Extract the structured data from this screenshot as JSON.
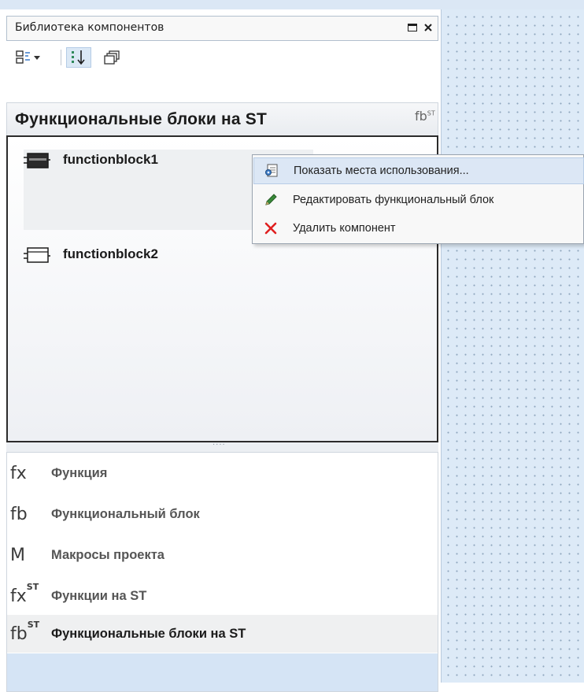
{
  "panel": {
    "title": "Библиотека компонентов"
  },
  "toolbar": {
    "view_mode_icon": "list-view-dropdown-icon",
    "sort_icon": "sort-order-icon",
    "group_icon": "copy-layers-icon"
  },
  "section": {
    "title": "Функциональные блоки на ST",
    "icon_text": "fbST"
  },
  "components": [
    {
      "name": "functionblock1",
      "selected": true
    },
    {
      "name": "functionblock2",
      "selected": false
    }
  ],
  "context_menu": {
    "items": [
      {
        "label": "Показать места использования...",
        "icon": "find-usages-icon"
      },
      {
        "label": "Редактировать функциональный блок",
        "icon": "pencil-icon"
      },
      {
        "label": "Удалить компонент",
        "icon": "red-x-delete-icon"
      }
    ]
  },
  "categories": [
    {
      "icon_main": "fx",
      "icon_sup": "",
      "label": "Функция"
    },
    {
      "icon_main": "fb",
      "icon_sup": "",
      "label": "Функциональный блок"
    },
    {
      "icon_main": "M",
      "icon_sup": "",
      "label": "Макросы проекта"
    },
    {
      "icon_main": "fx",
      "icon_sup": "ST",
      "label": "Функции на ST"
    },
    {
      "icon_main": "fb",
      "icon_sup": "ST",
      "label": "Функциональные блоки на ST"
    }
  ],
  "colors": {
    "canvas_bg": "#ddeaf7",
    "menu_highlight": "#dce7f5",
    "delete_red": "#e02020",
    "pencil_green": "#3a8a3a"
  }
}
